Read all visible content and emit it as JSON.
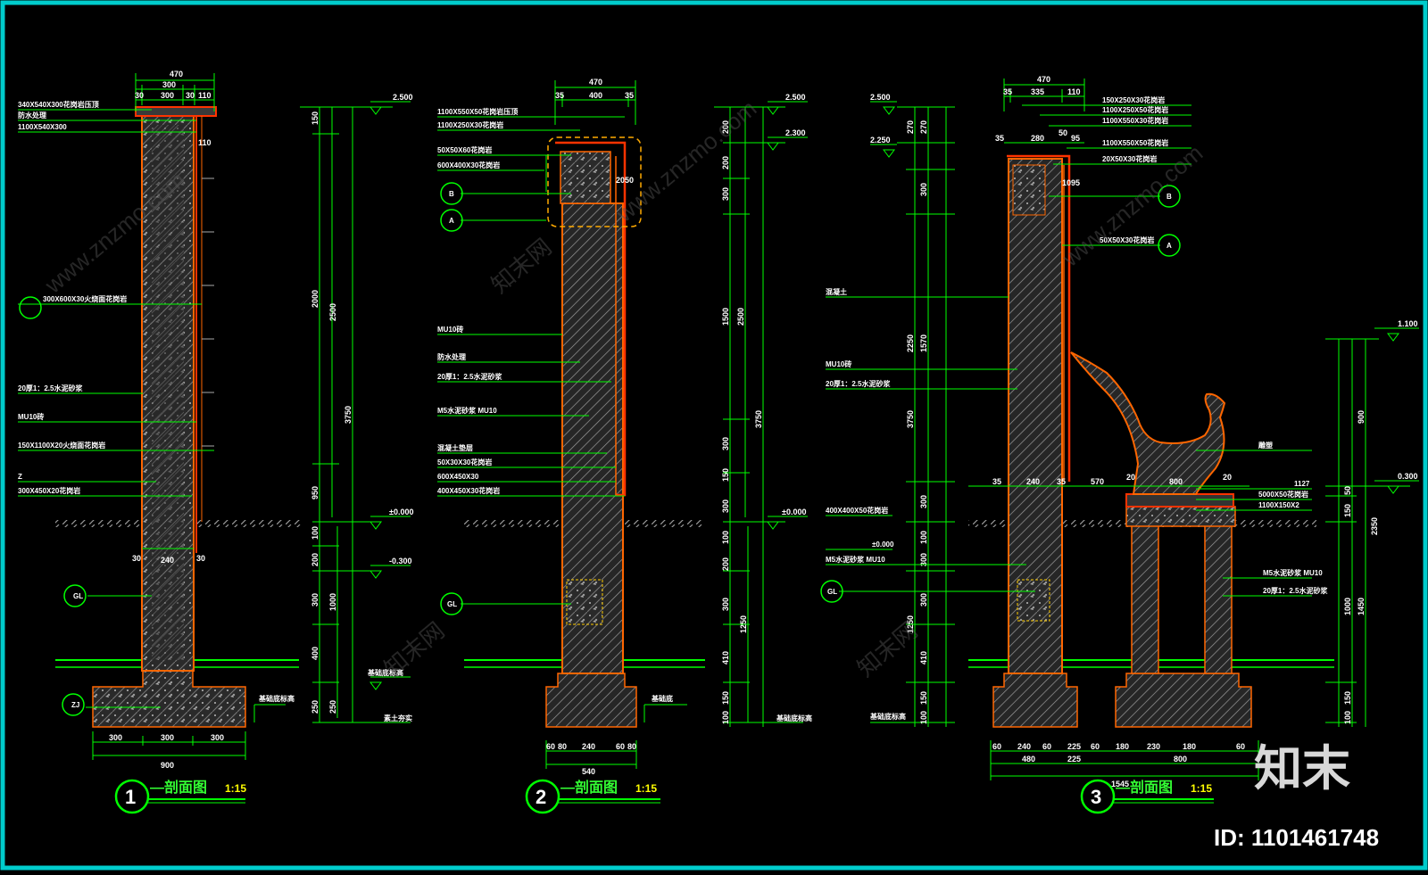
{
  "drawings": [
    {
      "id": "1",
      "title_suffix": "—剖面图",
      "scale": "1:15",
      "top_width": "470",
      "top_parts": [
        "30",
        "300",
        "30",
        "110"
      ],
      "upper_parts": [
        "30",
        "300",
        "30",
        "110"
      ],
      "bottom_parts": [
        "300",
        "300",
        "300"
      ],
      "bottom_total": "900",
      "wall_width": "240",
      "side_30": "30",
      "elev_top": "2.500",
      "elev_ground": "±0.000",
      "elev_minus": "-0.300",
      "elev_bottom": "基础底标高",
      "vdims": [
        "150",
        "2000",
        "950",
        "100",
        "200",
        "300",
        "400",
        "250"
      ],
      "vtotal": [
        "2500",
        "3750",
        "1000",
        "250"
      ],
      "notes": [
        "340X540X300花岗岩压顶",
        "防水处理",
        "1100X540X300",
        "300X600X30火烧面花岗岩",
        "20厚1：2.5水泥砂浆",
        "MU10砖",
        "150X1100X20火烧面花岗岩",
        "Z",
        "300X450X20花岗岩",
        "素土夯实"
      ],
      "markers": [
        "GL",
        "ZJ"
      ]
    },
    {
      "id": "2",
      "title_suffix": "—剖面图",
      "scale": "1:15",
      "top_width": "470",
      "top_parts": [
        "35",
        "400",
        "35"
      ],
      "bottom_parts": [
        "60",
        "80",
        "240",
        "60",
        "80"
      ],
      "bottom_total": "540",
      "elev_top": "2.500",
      "elev_2": "2.300",
      "elev_ground": "±0.000",
      "dim_2050": "2050",
      "vdims": [
        "200",
        "200",
        "300",
        "1500",
        "300",
        "150",
        "300",
        "100",
        "200",
        "300",
        "410",
        "150",
        "100"
      ],
      "vtotal": [
        "2500",
        "3750",
        "1250"
      ],
      "notes": [
        "1100X550X50花岗岩压顶",
        "1100X250X30花岗岩",
        "50X50X60花岗岩",
        "600X400X30花岗岩",
        "MU10砖",
        "防水处理",
        "20厚1：2.5水泥砂浆",
        "M5水泥砂浆 MU10",
        "混凝土垫层",
        "50X30X30花岗岩",
        "600X450X30",
        "400X450X30花岗岩"
      ],
      "markers": [
        "B",
        "A",
        "GL"
      ],
      "base_label": "基础底",
      "right_label": "基础底标高"
    },
    {
      "id": "3",
      "title_suffix": "—剖面图",
      "scale": "1:15",
      "top_width": "470",
      "top_parts": [
        "35",
        "335",
        "110"
      ],
      "mid_parts": [
        "35",
        "280",
        "50",
        "95"
      ],
      "bottom_parts": [
        "60",
        "60",
        "240",
        "60",
        "60",
        "225",
        "60",
        "60",
        "180",
        "230",
        "180",
        "60",
        "60"
      ],
      "bottom_sub": [
        "480",
        "225",
        "800"
      ],
      "bottom_total": "1545",
      "seat_parts": [
        "35",
        "240",
        "35",
        "570",
        "20",
        "800",
        "20"
      ],
      "elev_top": "2.500",
      "elev_2": "2.250",
      "elev_right": "1.100",
      "elev_right2": "0.300",
      "elev_ground": "±0.000",
      "dim_1095": "1095",
      "vdims": [
        "270",
        "270",
        "300",
        "2250",
        "1570",
        "300",
        "100",
        "300",
        "300",
        "410",
        "150",
        "100"
      ],
      "vtotal": [
        "3750",
        "1250"
      ],
      "right_vdims": [
        "900",
        "50",
        "150",
        "1000",
        "1450",
        "150",
        "100",
        "2350"
      ],
      "notes": [
        "150X250X30花岗岩",
        "1100X250X50花岗岩",
        "1100X550X30花岗岩",
        "1100X550X50花岗岩",
        "20X50X30花岗岩",
        "50X50X30花岗岩",
        "混凝土",
        "MU10砖",
        "20厚1：2.5水泥砂浆",
        "400X400X50花岗岩",
        "±0.000",
        "M5水泥砂浆 MU10",
        "雕塑",
        "1127",
        "5000X50花岗岩",
        "1100X150X2",
        "M5水泥砂浆 MU10",
        "20厚1：2.5水泥砂浆",
        "基础底标高"
      ],
      "markers": [
        "B",
        "A",
        "GL"
      ]
    }
  ],
  "watermark": {
    "logo": "知末",
    "id": "ID: 1101461748",
    "faint_url": "www.znzmo.com",
    "faint_cn": "知末网"
  },
  "colors": {
    "frame": "#00ffff",
    "leader": "#00ff00",
    "dim": "#00ff00",
    "hatch": "#8a8a8a",
    "outline": "#ff6600",
    "finish": "#ff3300",
    "ground": "#9a9a9a",
    "text": "#ffffff"
  }
}
